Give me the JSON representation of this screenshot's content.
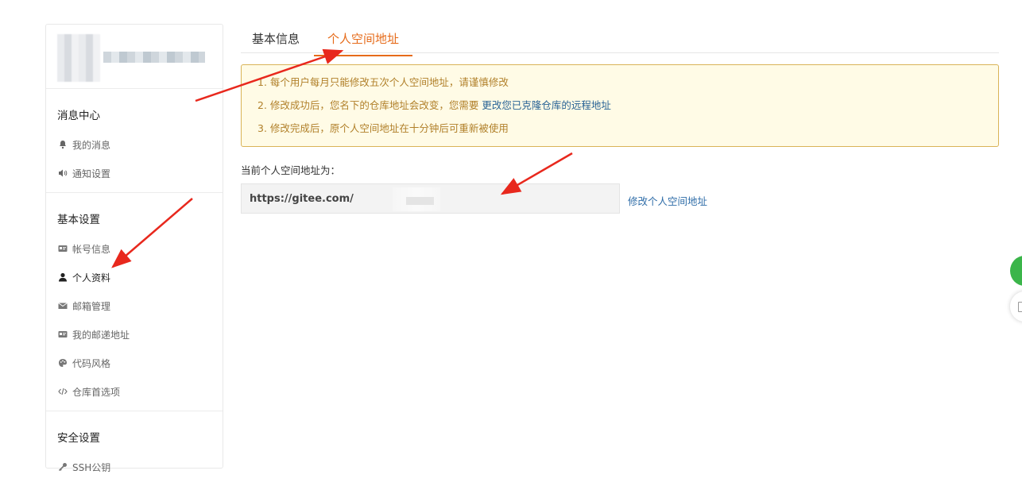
{
  "sidebar": {
    "sections": [
      {
        "title": "消息中心",
        "items": [
          {
            "label": "我的消息",
            "icon": "bell-icon"
          },
          {
            "label": "通知设置",
            "icon": "volume-icon"
          }
        ]
      },
      {
        "title": "基本设置",
        "items": [
          {
            "label": "帐号信息",
            "icon": "id-card-icon"
          },
          {
            "label": "个人资料",
            "icon": "user-icon"
          },
          {
            "label": "邮箱管理",
            "icon": "envelope-icon"
          },
          {
            "label": "我的邮递地址",
            "icon": "id-card-icon"
          },
          {
            "label": "代码风格",
            "icon": "palette-icon"
          },
          {
            "label": "仓库首选项",
            "icon": "code-icon"
          }
        ]
      },
      {
        "title": "安全设置",
        "items": [
          {
            "label": "SSH公钥",
            "icon": "key-icon"
          }
        ]
      }
    ]
  },
  "tabs": {
    "basic": "基本信息",
    "space": "个人空间地址"
  },
  "notice": {
    "line1": "1. 每个用户每月只能修改五次个人空间地址，请谨慎修改",
    "line2_prefix": "2. 修改成功后，您名下的仓库地址会改变，您需要",
    "line2_link": "更改您已克隆仓库的远程地址",
    "line3": "3. 修改完成后，原个人空间地址在十分钟后可重新被使用"
  },
  "current": {
    "label": "当前个人空间地址为：",
    "url_prefix": "https://gitee.com/",
    "modify_link": "修改个人空间地址"
  },
  "colors": {
    "accent": "#e66b1a",
    "notice_bg": "#fffbe6",
    "notice_border": "#d9b357",
    "link": "#2f6da8",
    "arrow": "#e8281d"
  }
}
